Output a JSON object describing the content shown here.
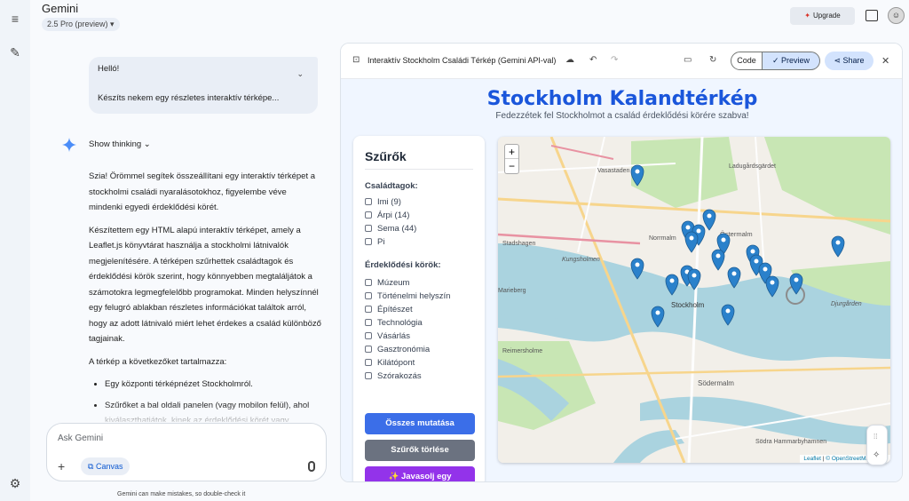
{
  "app": {
    "title": "Gemini",
    "model": "2.5 Pro (preview) ▾"
  },
  "header": {
    "upgrade": "Upgrade"
  },
  "chat": {
    "user_line1": "Helló!",
    "user_line2": "Készíts nekem egy részletes interaktív térképe...",
    "show_thinking": "Show thinking",
    "paragraphs": [
      "Szia! Örömmel segítek összeállítani egy interaktív térképet a stockholmi családi nyaralásotokhoz, figyelembe véve mindenki egyedi érdeklődési körét.",
      "Készítettem egy HTML alapú interaktív térképet, amely a Leaflet.js könyvtárat használja a stockholmi látnivalók megjelenítésére. A térképen szűrhettek családtagok és érdeklődési körök szerint, hogy könnyebben megtaláljátok a számotokra legmegfelelőbb programokat. Minden helyszínnél egy felugró ablakban részletes információkat találtok arról, hogy az adott látnivaló miért lehet érdekes a család különböző tagjainak.",
      "A térkép a következőket tartalmazza:"
    ],
    "bullets": [
      "Egy központi térképnézet Stockholmról.",
      "Szűrőket a bal oldali panelen (vagy mobilon felül), ahol kiválaszthatjátok, kinek az érdeklődési körét vagy"
    ],
    "input_placeholder": "Ask Gemini",
    "canvas": "Canvas",
    "disclaimer": "Gemini can make mistakes, so double-check it"
  },
  "canvas_panel": {
    "title": "Interaktív Stockholm Családi Térkép (Gemini API-val)",
    "code": "Code",
    "preview": "✓  Preview",
    "share": "Share"
  },
  "page": {
    "heading": "Stockholm Kalandtérkép",
    "subheading": "Fedezzétek fel Stockholmot a család érdeklődési körére szabva!",
    "filters_title": "Szűrők",
    "family_label": "Családtagok:",
    "family": [
      "Imi (9)",
      "Árpi (14)",
      "Sema (44)",
      "Pi"
    ],
    "interests_label": "Érdeklődési körök:",
    "interests": [
      "Múzeum",
      "Történelmi helyszín",
      "Építészet",
      "Technológia",
      "Vásárlás",
      "Gasztronómia",
      "Kilátópont",
      "Szórakozás"
    ],
    "btn_show_all": "Összes mutatása",
    "btn_clear": "Szűrők törlése",
    "btn_suggest": "✨ Javasolj egy",
    "map_labels": {
      "vasastaden": "Vasastaden",
      "norrmalm": "Norrmalm",
      "ostermalm": "Östermalm",
      "stockholm": "Stockholm",
      "sodermalm": "Södermalm",
      "kungsholmen": "Kungsholmen",
      "djurgarden": "Djurgården",
      "reimersholme": "Reimersholme",
      "stadshagen": "Stadshagen",
      "marieberg": "Marieberg",
      "ladugardsgardet": "Ladugårdsgärdet",
      "hammarby": "Södra Hammarbyhamnen"
    },
    "map_attribution_leaflet": "Leaflet",
    "map_attribution_osm": "© OpenStreetMap contr"
  },
  "colors": {
    "heading": "#1a56db",
    "btn_show_all": "#3b6ee8",
    "btn_clear": "#6b7280",
    "btn_suggest": "#9333ea",
    "marker": "#2a81cb",
    "water": "#aad3df",
    "park": "#c8e6b4"
  }
}
